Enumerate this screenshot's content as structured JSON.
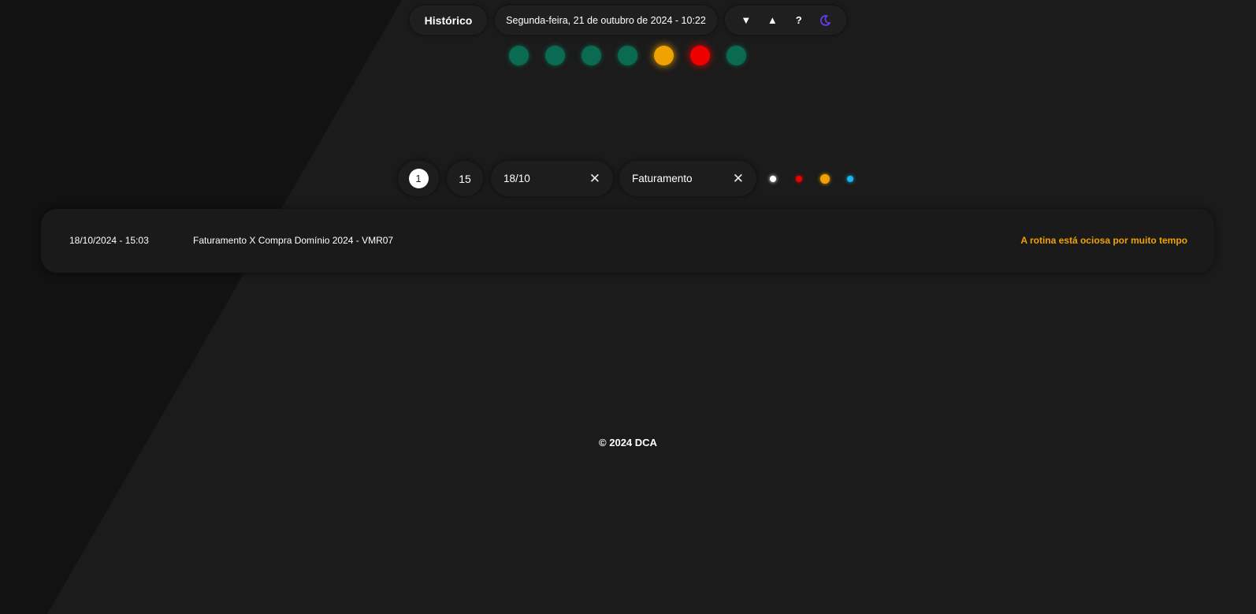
{
  "header": {
    "history_label": "Histórico",
    "datetime": "Segunda-feira, 21 de outubro de 2024 - 10:22",
    "icons": {
      "collapse": "▼",
      "expand": "▲",
      "help": "?"
    }
  },
  "status_dots": [
    {
      "status": "ok",
      "color": "#0b6b52"
    },
    {
      "status": "ok",
      "color": "#0b6b52"
    },
    {
      "status": "ok",
      "color": "#0b6b52"
    },
    {
      "status": "ok",
      "color": "#0b6b52"
    },
    {
      "status": "warning",
      "color": "#f0a202"
    },
    {
      "status": "error",
      "color": "#ee0000"
    },
    {
      "status": "ok",
      "color": "#0b6b52"
    }
  ],
  "filters": {
    "current_page": "1",
    "page_size": "15",
    "date": "18/10",
    "category": "Faturamento",
    "clear_icon": "✕",
    "legend_colors": [
      "#ffffff",
      "#ee0000",
      "#f0a202",
      "#19b6f0"
    ]
  },
  "results": [
    {
      "datetime": "18/10/2024 - 15:03",
      "title": "Faturamento X Compra Domínio 2024 - VMR07",
      "status_text": "A rotina está ociosa por muito tempo"
    }
  ],
  "footer": {
    "copyright": "© 2024 DCA"
  }
}
